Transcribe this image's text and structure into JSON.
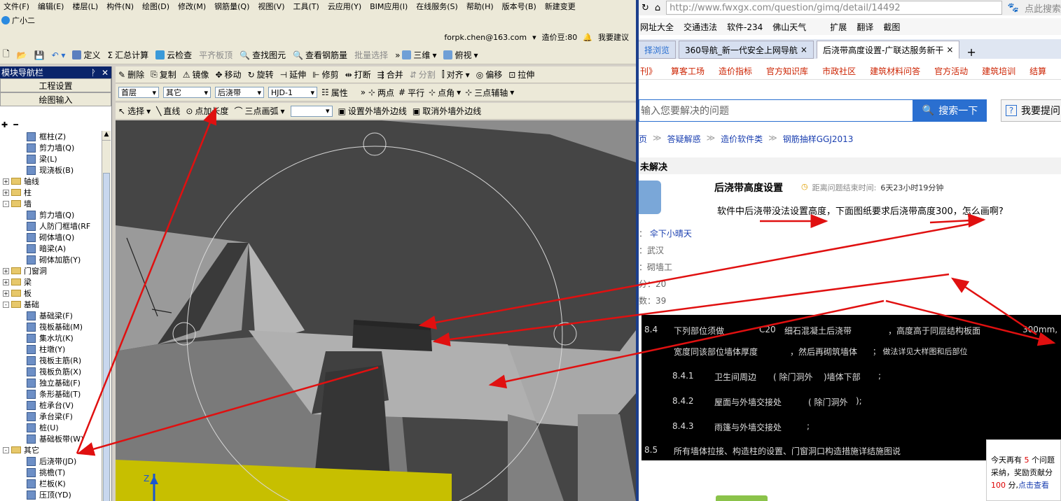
{
  "app": {
    "menus": [
      "文件(F)",
      "编辑(E)",
      "楼层(L)",
      "构件(N)",
      "绘图(D)",
      "修改(M)",
      "钢筋量(Q)",
      "视图(V)",
      "工具(T)",
      "云应用(Y)",
      "BIM应用(I)",
      "在线服务(S)",
      "帮助(H)",
      "版本号(B)",
      "新建变更"
    ],
    "assistant_label": "广小二",
    "account": "forpk.chen@163.com",
    "price_points": "造价豆:80",
    "suggest_label": "我要建议",
    "toolbar1": {
      "define": "定义",
      "sum": "汇总计算",
      "cloud_check": "云检查",
      "flat_top": "平齐板顶",
      "find_elem": "查找图元",
      "view_rebar": "查看钢筋量",
      "batch_select": "批量选择",
      "view_3d": "三维",
      "view_top": "俯视"
    },
    "toolbar2": {
      "delete": "删除",
      "copy": "复制",
      "mirror": "镜像",
      "move": "移动",
      "rotate": "旋转",
      "extend": "延伸",
      "trim": "修剪",
      "break": "打断",
      "merge": "合并",
      "split": "分割",
      "align": "对齐",
      "offset": "偏移",
      "stretch": "拉伸"
    },
    "toolbar3": {
      "floor": "首层",
      "category": "其它",
      "component": "后浇带",
      "name": "HJD-1",
      "props": "属性",
      "two_points": "两点",
      "parallel": "平行",
      "point_angle": "点角",
      "three_point_aux": "三点辅轴"
    },
    "toolbar4": {
      "select": "选择",
      "line": "直线",
      "point_len": "点加长度",
      "three_arc": "三点画弧",
      "set_outer": "设置外墙外边线",
      "cancel_outer": "取消外墙外边线"
    },
    "nav": {
      "title": "模块导航栏",
      "btn_project": "工程设置",
      "btn_draw": "绘图输入",
      "tree": [
        {
          "label": "框柱(Z)",
          "level": 2,
          "type": "item"
        },
        {
          "label": "剪力墙(Q)",
          "level": 2,
          "type": "item"
        },
        {
          "label": "梁(L)",
          "level": 2,
          "type": "item"
        },
        {
          "label": "现浇板(B)",
          "level": 2,
          "type": "item"
        },
        {
          "label": "轴线",
          "level": 0,
          "type": "folder",
          "sign": "+"
        },
        {
          "label": "柱",
          "level": 0,
          "type": "folder",
          "sign": "+"
        },
        {
          "label": "墙",
          "level": 0,
          "type": "folder",
          "sign": "-"
        },
        {
          "label": "剪力墙(Q)",
          "level": 2,
          "type": "item"
        },
        {
          "label": "人防门框墙(RF",
          "level": 2,
          "type": "item"
        },
        {
          "label": "砌体墙(Q)",
          "level": 2,
          "type": "item"
        },
        {
          "label": "暗梁(A)",
          "level": 2,
          "type": "item"
        },
        {
          "label": "砌体加筋(Y)",
          "level": 2,
          "type": "item"
        },
        {
          "label": "门窗洞",
          "level": 0,
          "type": "folder",
          "sign": "+"
        },
        {
          "label": "梁",
          "level": 0,
          "type": "folder",
          "sign": "+"
        },
        {
          "label": "板",
          "level": 0,
          "type": "folder",
          "sign": "+"
        },
        {
          "label": "基础",
          "level": 0,
          "type": "folder",
          "sign": "-"
        },
        {
          "label": "基础梁(F)",
          "level": 2,
          "type": "item"
        },
        {
          "label": "筏板基础(M)",
          "level": 2,
          "type": "item"
        },
        {
          "label": "集水坑(K)",
          "level": 2,
          "type": "item"
        },
        {
          "label": "柱墩(Y)",
          "level": 2,
          "type": "item"
        },
        {
          "label": "筏板主筋(R)",
          "level": 2,
          "type": "item"
        },
        {
          "label": "筏板负筋(X)",
          "level": 2,
          "type": "item"
        },
        {
          "label": "独立基础(F)",
          "level": 2,
          "type": "item"
        },
        {
          "label": "条形基础(T)",
          "level": 2,
          "type": "item"
        },
        {
          "label": "桩承台(V)",
          "level": 2,
          "type": "item"
        },
        {
          "label": "承台梁(F)",
          "level": 2,
          "type": "item"
        },
        {
          "label": "桩(U)",
          "level": 2,
          "type": "item"
        },
        {
          "label": "基础板带(W)",
          "level": 2,
          "type": "item"
        },
        {
          "label": "其它",
          "level": 0,
          "type": "folder",
          "sign": "-"
        },
        {
          "label": "后浇带(JD)",
          "level": 2,
          "type": "item"
        },
        {
          "label": "挑檐(T)",
          "level": 2,
          "type": "item"
        },
        {
          "label": "栏板(K)",
          "level": 2,
          "type": "item"
        },
        {
          "label": "压顶(YD)",
          "level": 2,
          "type": "item"
        }
      ]
    },
    "axis_z": "Z"
  },
  "browser": {
    "url": "http://www.fwxgx.com/question/gimq/detail/14492",
    "search_here": "点此搜索",
    "bookmarks": [
      "网址大全",
      "交通违法",
      "软件-234",
      "佛山天气",
      "扩展",
      "翻译",
      "截图"
    ],
    "tabs": [
      "择浏览",
      "360导航_新一代安全上网导航",
      "后浇带高度设置-广联达服务新干"
    ],
    "nav_links": [
      "刊》",
      "算客工场",
      "造价指标",
      "官方知识库",
      "市政社区",
      "建筑材料问答",
      "官方活动",
      "建筑培训",
      "结算"
    ],
    "search_placeholder": "输入您要解决的问题",
    "search_button": "搜索一下",
    "ask_button": "我要提问",
    "breadcrumb": [
      "页",
      "答疑解惑",
      "造价软件类",
      "钢筋抽样GGJ2013"
    ],
    "status": "未解决",
    "question_title": "后浇带高度设置",
    "deadline_label": "距离问题结束时间:",
    "deadline_value": "6天23小时19分钟",
    "question_text": "软件中后浇带没法设置高度，下面图纸要求后浇带高度300，怎么画啊?",
    "asker_label": "：",
    "asker": "伞下小晴天",
    "city_label": "：",
    "city": "武汉",
    "job_label": "：",
    "job": "砌墙工",
    "score_label": "分：",
    "score": "20",
    "count_label": "数：",
    "count": "39",
    "drawing_lines": [
      {
        "no": "8.4",
        "text": "下列部位须做",
        "c": "C20",
        "desc": "细石混凝土后浇带",
        "tail": "，高度高于同层结构板面",
        "val": "300mm,"
      },
      {
        "no": "",
        "text": "宽度同该部位墙体厚度",
        "c": "",
        "desc": "，然后再砌筑墙体",
        "tail": "；  做法详见大样图和后部位",
        "val": ""
      },
      {
        "no": "8.4.1",
        "text": "卫生间周边",
        "c": "",
        "desc": "( 除门洞外",
        "tail": ")墙体下部",
        "val": ";"
      },
      {
        "no": "8.4.2",
        "text": "屋面与外墙交接处",
        "c": "",
        "desc": "( 除门洞外",
        "tail": ");",
        "val": ""
      },
      {
        "no": "8.4.3",
        "text": "雨篷与外墙交接处",
        "c": "",
        "desc": "",
        "tail": ";",
        "val": ""
      },
      {
        "no": "8.5",
        "text": "所有墙体拉接、构造柱的设置、门窗洞口构造措施详结施图说",
        "c": "",
        "desc": "",
        "tail": "",
        "val": ""
      }
    ],
    "popup": {
      "line1": "今天再有",
      "num": "5",
      "line1b": "个问题",
      "line2": "采纳，奖励贡献分",
      "pts": "100",
      "line3": "分,",
      "link": "点击查看"
    }
  },
  "colors": {
    "arrow": "#e01010",
    "title_bar": "#0a246a",
    "accent_blue": "#2a6fd0",
    "link_red": "#cc2200"
  }
}
